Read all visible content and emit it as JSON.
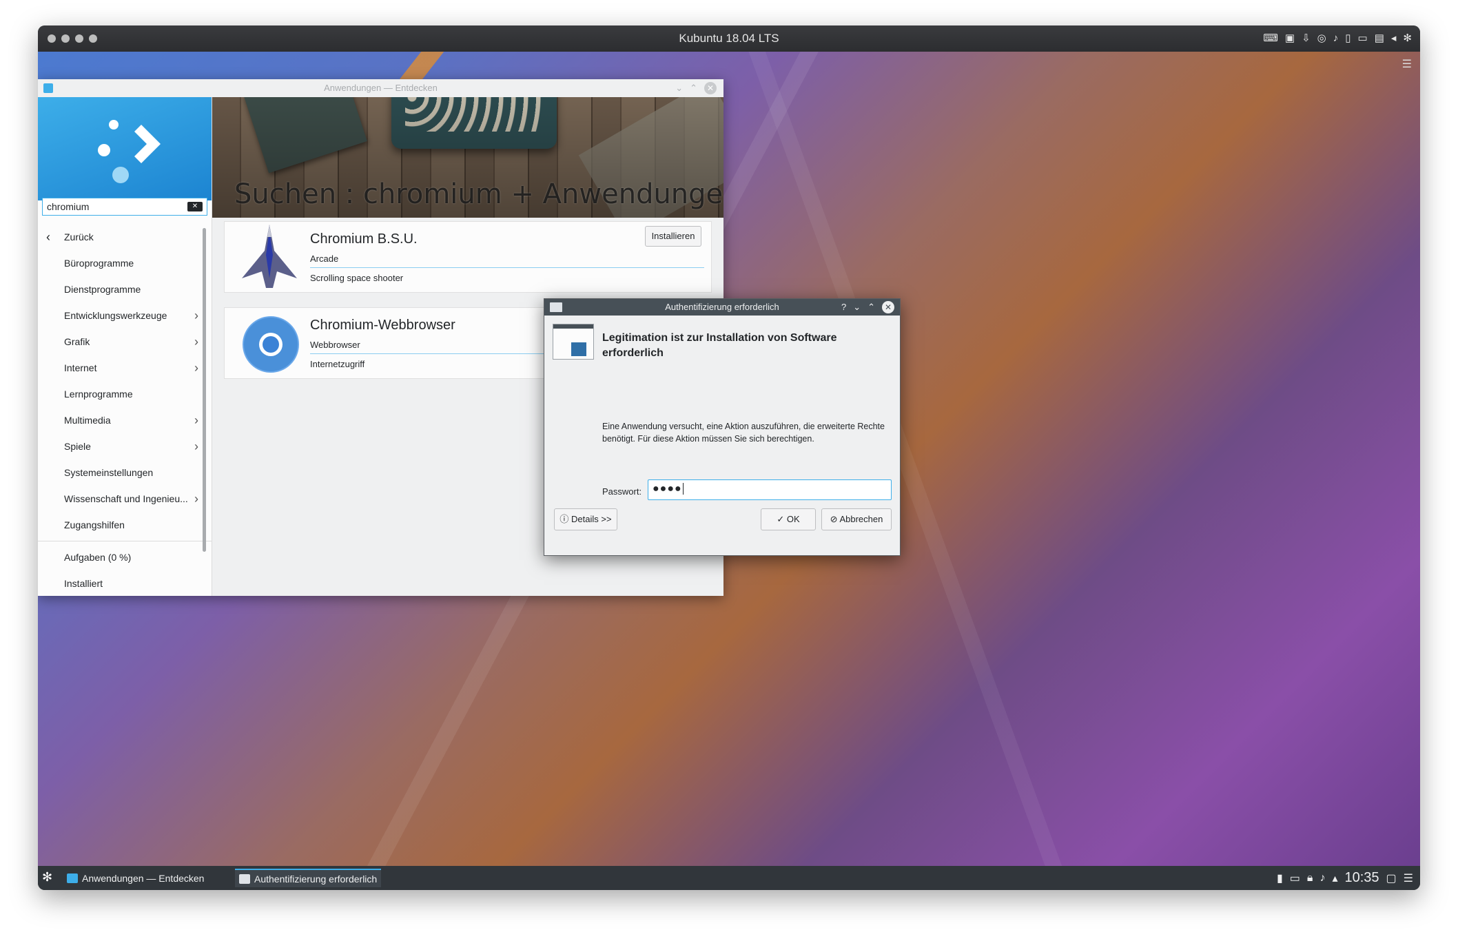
{
  "vm": {
    "title": "Kubuntu 18.04 LTS"
  },
  "discover": {
    "window_title": "Anwendungen — Entdecken",
    "search_value": "chromium",
    "nav": {
      "back": "Zurück",
      "items": [
        {
          "label": "Büroprogramme",
          "has_children": false
        },
        {
          "label": "Dienstprogramme",
          "has_children": false
        },
        {
          "label": "Entwicklungswerkzeuge",
          "has_children": true
        },
        {
          "label": "Grafik",
          "has_children": true
        },
        {
          "label": "Internet",
          "has_children": true
        },
        {
          "label": "Lernprogramme",
          "has_children": false
        },
        {
          "label": "Multimedia",
          "has_children": true
        },
        {
          "label": "Spiele",
          "has_children": true
        },
        {
          "label": "Systemeinstellungen",
          "has_children": false
        },
        {
          "label": "Wissenschaft und Ingenieu...",
          "has_children": true
        },
        {
          "label": "Zugangshilfen",
          "has_children": false
        }
      ],
      "tasks": "Aufgaben (0 %)",
      "installed": "Installiert"
    },
    "banner_text": "Suchen : chromium + Anwendungen",
    "results": [
      {
        "name": "Chromium B.S.U.",
        "category": "Arcade",
        "description": "Scrolling space shooter",
        "install_label": "Installieren"
      },
      {
        "name": "Chromium-Webbrowser",
        "category": "Webbrowser",
        "description": "Internetzugriff"
      }
    ]
  },
  "dialog": {
    "title": "Authentifizierung erforderlich",
    "heading": "Legitimation ist zur Installation von Software erforderlich",
    "body": "Eine Anwendung versucht, eine Aktion auszuführen, die erweiterte Rechte benötigt. Für diese Aktion müssen Sie sich berechtigen.",
    "password_label": "Passwort:",
    "password_value": "●●●●",
    "details_label": "Details >>",
    "ok_label": "OK",
    "cancel_label": "Abbrechen"
  },
  "taskbar": {
    "tasks": [
      "Anwendungen — Entdecken",
      "Authentifizierung erforderlich"
    ],
    "clock": "10:35"
  },
  "colors": {
    "accent": "#3daee9",
    "panel": "#31363b",
    "dialog_title": "#475057"
  }
}
